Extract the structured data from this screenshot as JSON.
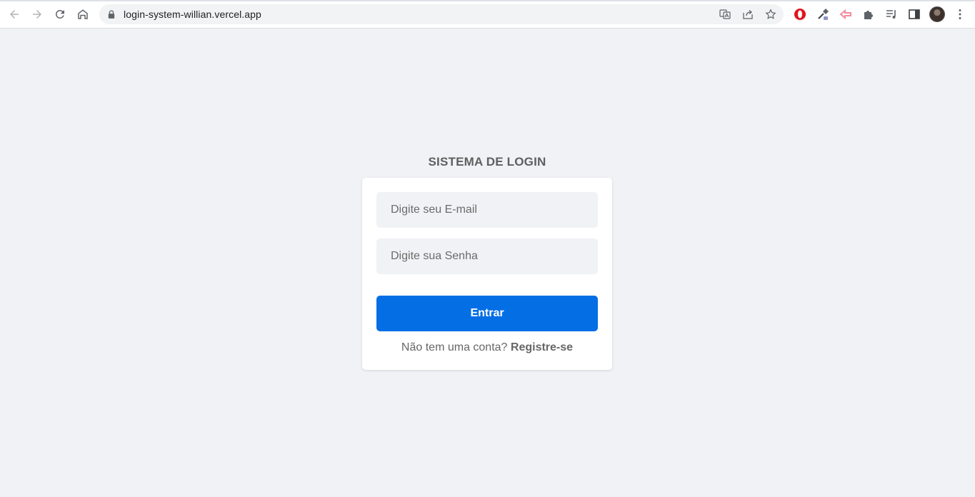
{
  "browser": {
    "url": "login-system-willian.vercel.app",
    "icons": [
      "back-icon",
      "forward-icon",
      "reload-icon",
      "home-icon",
      "lock-icon",
      "translate-icon",
      "share-icon",
      "bookmark-star-icon",
      "opera-extension-icon",
      "eyedropper-extension-icon",
      "extension-icon-pink",
      "puzzle-icon",
      "media-control-icon",
      "side-panel-icon",
      "profile-avatar",
      "kebab-menu-icon"
    ]
  },
  "login": {
    "title": "SISTEMA DE LOGIN",
    "email_placeholder": "Digite seu E-mail",
    "password_placeholder": "Digite sua Senha",
    "submit_label": "Entrar",
    "register_prompt": "Não tem uma conta?",
    "register_link": "Registre-se"
  },
  "colors": {
    "page_background": "#f0f2f5",
    "primary_button": "#046ee5",
    "card_background": "#ffffff",
    "input_background": "#f0f2f5"
  }
}
